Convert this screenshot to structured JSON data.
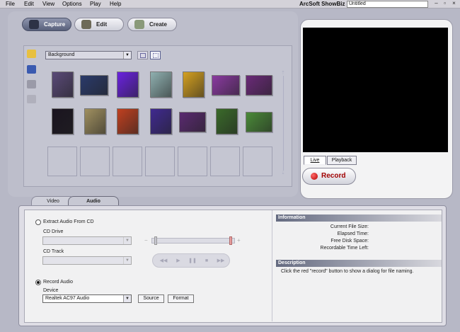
{
  "menu": [
    "File",
    "Edit",
    "View",
    "Options",
    "Play",
    "Help"
  ],
  "app_title": "ArcSoft ShowBiz",
  "project_name": "Untitled",
  "mode_tabs": {
    "capture": "Capture",
    "edit": "Edit",
    "create": "Create"
  },
  "gallery": {
    "category": "Background",
    "thumbs_row1": [
      "#5a4a78",
      "#2a3a6a",
      "#6a22e0",
      "#8fb0b0",
      "#d4a020",
      "#8a3aa0",
      "#6a2a78"
    ],
    "thumbs_row2": [
      "#1a1420",
      "#a09060",
      "#c04020",
      "#402a90",
      "#5a2a70",
      "#3a6a2a",
      "#4a8a38"
    ]
  },
  "preview": {
    "live_tab": "Live",
    "playback_tab": "Playback",
    "record_button": "Record"
  },
  "bottom_tabs": {
    "video": "Video",
    "audio": "Audio"
  },
  "audio": {
    "extract_label": "Extract Audio From CD",
    "cd_drive_label": "CD Drive",
    "cd_track_label": "CD Track",
    "record_label": "Record Audio",
    "device_label": "Device",
    "device_value": "Realtek AC97 Audio",
    "source_button": "Source",
    "format_button": "Format"
  },
  "information": {
    "title": "Information",
    "file_size": "Current File Size:",
    "elapsed": "Elapsed Time:",
    "free_disk": "Free Disk Space:",
    "rec_left": "Recordable Time Left:"
  },
  "description": {
    "title": "Description",
    "text": "Click the red \"record\" button to show a dialog for file naming."
  }
}
